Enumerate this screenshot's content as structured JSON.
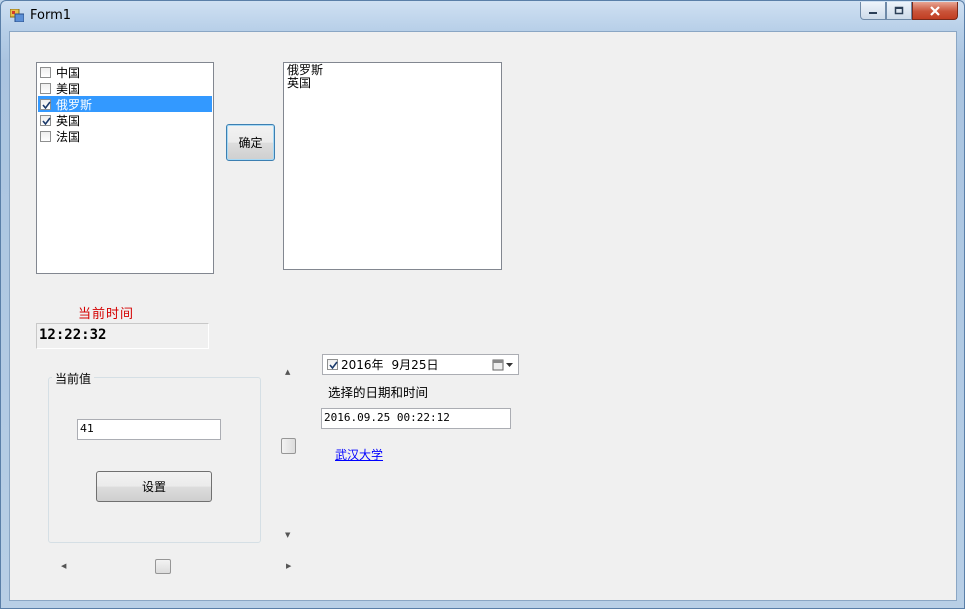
{
  "window": {
    "title": "Form1"
  },
  "checked_list": [
    {
      "label": "中国",
      "checked": false,
      "selected": false
    },
    {
      "label": "美国",
      "checked": false,
      "selected": false
    },
    {
      "label": "俄罗斯",
      "checked": true,
      "selected": true
    },
    {
      "label": "英国",
      "checked": true,
      "selected": false
    },
    {
      "label": "法国",
      "checked": false,
      "selected": false
    }
  ],
  "confirm_button": "确定",
  "result_list": [
    "俄罗斯",
    "英国"
  ],
  "clock": {
    "label": "当前时间",
    "value": "12:22:32"
  },
  "group": {
    "title": "当前值",
    "value": "41",
    "set_button": "设置"
  },
  "date_picker": {
    "checked": true,
    "year": "2016年",
    "date": "9月25日"
  },
  "date_caption": "选择的日期和时间",
  "datetime_value": "2016.09.25 00:22:12",
  "link": "武汉大学",
  "colors": {
    "selection": "#3399ff",
    "time_label": "#d40000",
    "link": "#0000ff"
  }
}
